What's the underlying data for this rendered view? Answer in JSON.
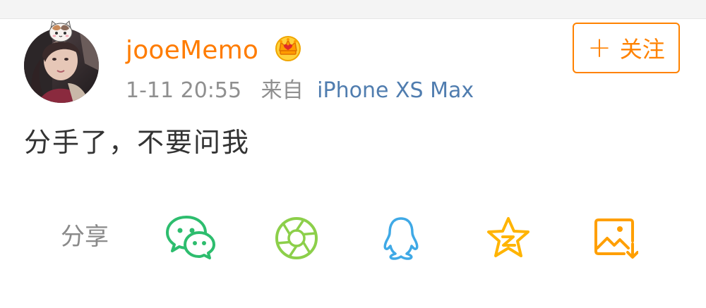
{
  "post": {
    "username": "jooeMemo",
    "timestamp": "1-11 20:55",
    "source_prefix": "来自",
    "source_device": "iPhone XS Max",
    "content": "分手了，不要问我"
  },
  "follow_button": {
    "label": "关注",
    "plus": "+"
  },
  "share": {
    "label": "分享",
    "icons": [
      "wechat-icon",
      "moments-icon",
      "qq-icon",
      "qzone-icon",
      "save-image-icon"
    ]
  },
  "colors": {
    "username": "#ff7c00",
    "follow": "#ff8200",
    "device_link": "#507daf",
    "wechat": "#2dbd6e",
    "moments": "#8ccf4a",
    "qq": "#3fa9e6",
    "qzone": "#ffb400",
    "save_image": "#ff9f00"
  }
}
